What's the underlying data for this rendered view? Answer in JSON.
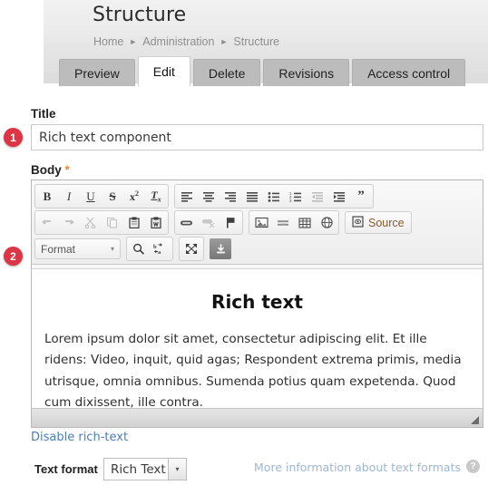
{
  "header": {
    "title": "Structure",
    "breadcrumb": [
      {
        "label": "Home",
        "sep": "►"
      },
      {
        "label": "Administration",
        "sep": "►"
      },
      {
        "label": "Structure",
        "sep": ""
      }
    ]
  },
  "tabs": [
    {
      "label": "Preview",
      "active": false
    },
    {
      "label": "Edit",
      "active": true
    },
    {
      "label": "Delete",
      "active": false
    },
    {
      "label": "Revisions",
      "active": false
    },
    {
      "label": "Access control",
      "active": false
    }
  ],
  "badges": {
    "one": "1",
    "two": "2",
    "color": "#dc3545"
  },
  "form": {
    "title_label": "Title",
    "title_value": "Rich text component",
    "title_placeholder": "",
    "body_label": "Body",
    "body_required_marker": "*"
  },
  "editor": {
    "toolbar_row1": {
      "group_basic": [
        {
          "icon": "bold-icon",
          "label": "B",
          "disabled": false
        },
        {
          "icon": "italic-icon",
          "label": "I",
          "disabled": false
        },
        {
          "icon": "underline-icon",
          "label": "U",
          "disabled": false
        },
        {
          "icon": "strikethrough-icon",
          "label": "S",
          "disabled": false
        },
        {
          "icon": "superscript-icon",
          "label": "x²",
          "disabled": false
        },
        {
          "icon": "remove-format-icon",
          "label": "Tx",
          "disabled": false
        }
      ],
      "group_paragraph": [
        {
          "icon": "align-left-icon",
          "disabled": false
        },
        {
          "icon": "align-center-icon",
          "disabled": false
        },
        {
          "icon": "align-right-icon",
          "disabled": false
        },
        {
          "icon": "align-justify-icon",
          "disabled": false
        },
        {
          "icon": "bulleted-list-icon",
          "disabled": false
        },
        {
          "icon": "numbered-list-icon",
          "disabled": false
        },
        {
          "icon": "outdent-icon",
          "disabled": true
        },
        {
          "icon": "indent-icon",
          "disabled": false
        },
        {
          "icon": "blockquote-icon",
          "label": "”",
          "disabled": false
        }
      ]
    },
    "toolbar_row2": {
      "group_clipboard": [
        {
          "icon": "undo-icon",
          "disabled": true
        },
        {
          "icon": "redo-icon",
          "disabled": true
        },
        {
          "icon": "cut-icon",
          "disabled": true
        },
        {
          "icon": "copy-icon",
          "disabled": true
        },
        {
          "icon": "paste-icon",
          "disabled": false
        },
        {
          "icon": "paste-from-word-icon",
          "disabled": false
        }
      ],
      "group_links": [
        {
          "icon": "link-icon",
          "disabled": false
        },
        {
          "icon": "unlink-icon",
          "disabled": true
        },
        {
          "icon": "anchor-flag-icon",
          "disabled": false
        }
      ],
      "group_insert": [
        {
          "icon": "image-icon",
          "disabled": false
        },
        {
          "icon": "horizontal-rule-icon",
          "disabled": false
        },
        {
          "icon": "table-icon",
          "disabled": false
        },
        {
          "icon": "iframe-globe-icon",
          "disabled": false
        }
      ],
      "source_button": {
        "label": "Source",
        "icon": "source-document-icon"
      }
    },
    "toolbar_row3": {
      "format_select": {
        "label": "Format",
        "caret": "▾"
      },
      "group_tools": [
        {
          "icon": "find-search-icon",
          "disabled": false
        },
        {
          "icon": "replace-icon",
          "disabled": false
        }
      ],
      "group_view": [
        {
          "icon": "maximize-icon",
          "disabled": false
        }
      ],
      "save_button": {
        "icon": "save-download-icon"
      }
    },
    "content": {
      "heading": "Rich text",
      "paragraph": "Lorem ipsum dolor sit amet, consectetur adipiscing elit. Et ille ridens: Video, inquit, quid agas; Respondent extrema primis, media utrisque, omnia omnibus. Sumenda potius quam expetenda. Quod cum dixissent, ille contra."
    },
    "resize_handle": "resize-grip-icon"
  },
  "footer": {
    "disable_rich_text": "Disable rich-text",
    "text_format_label": "Text format",
    "text_format_value": "Rich Text",
    "text_format_caret": "▾",
    "more_info_link": "More information about text formats",
    "help_icon_label": "?"
  }
}
